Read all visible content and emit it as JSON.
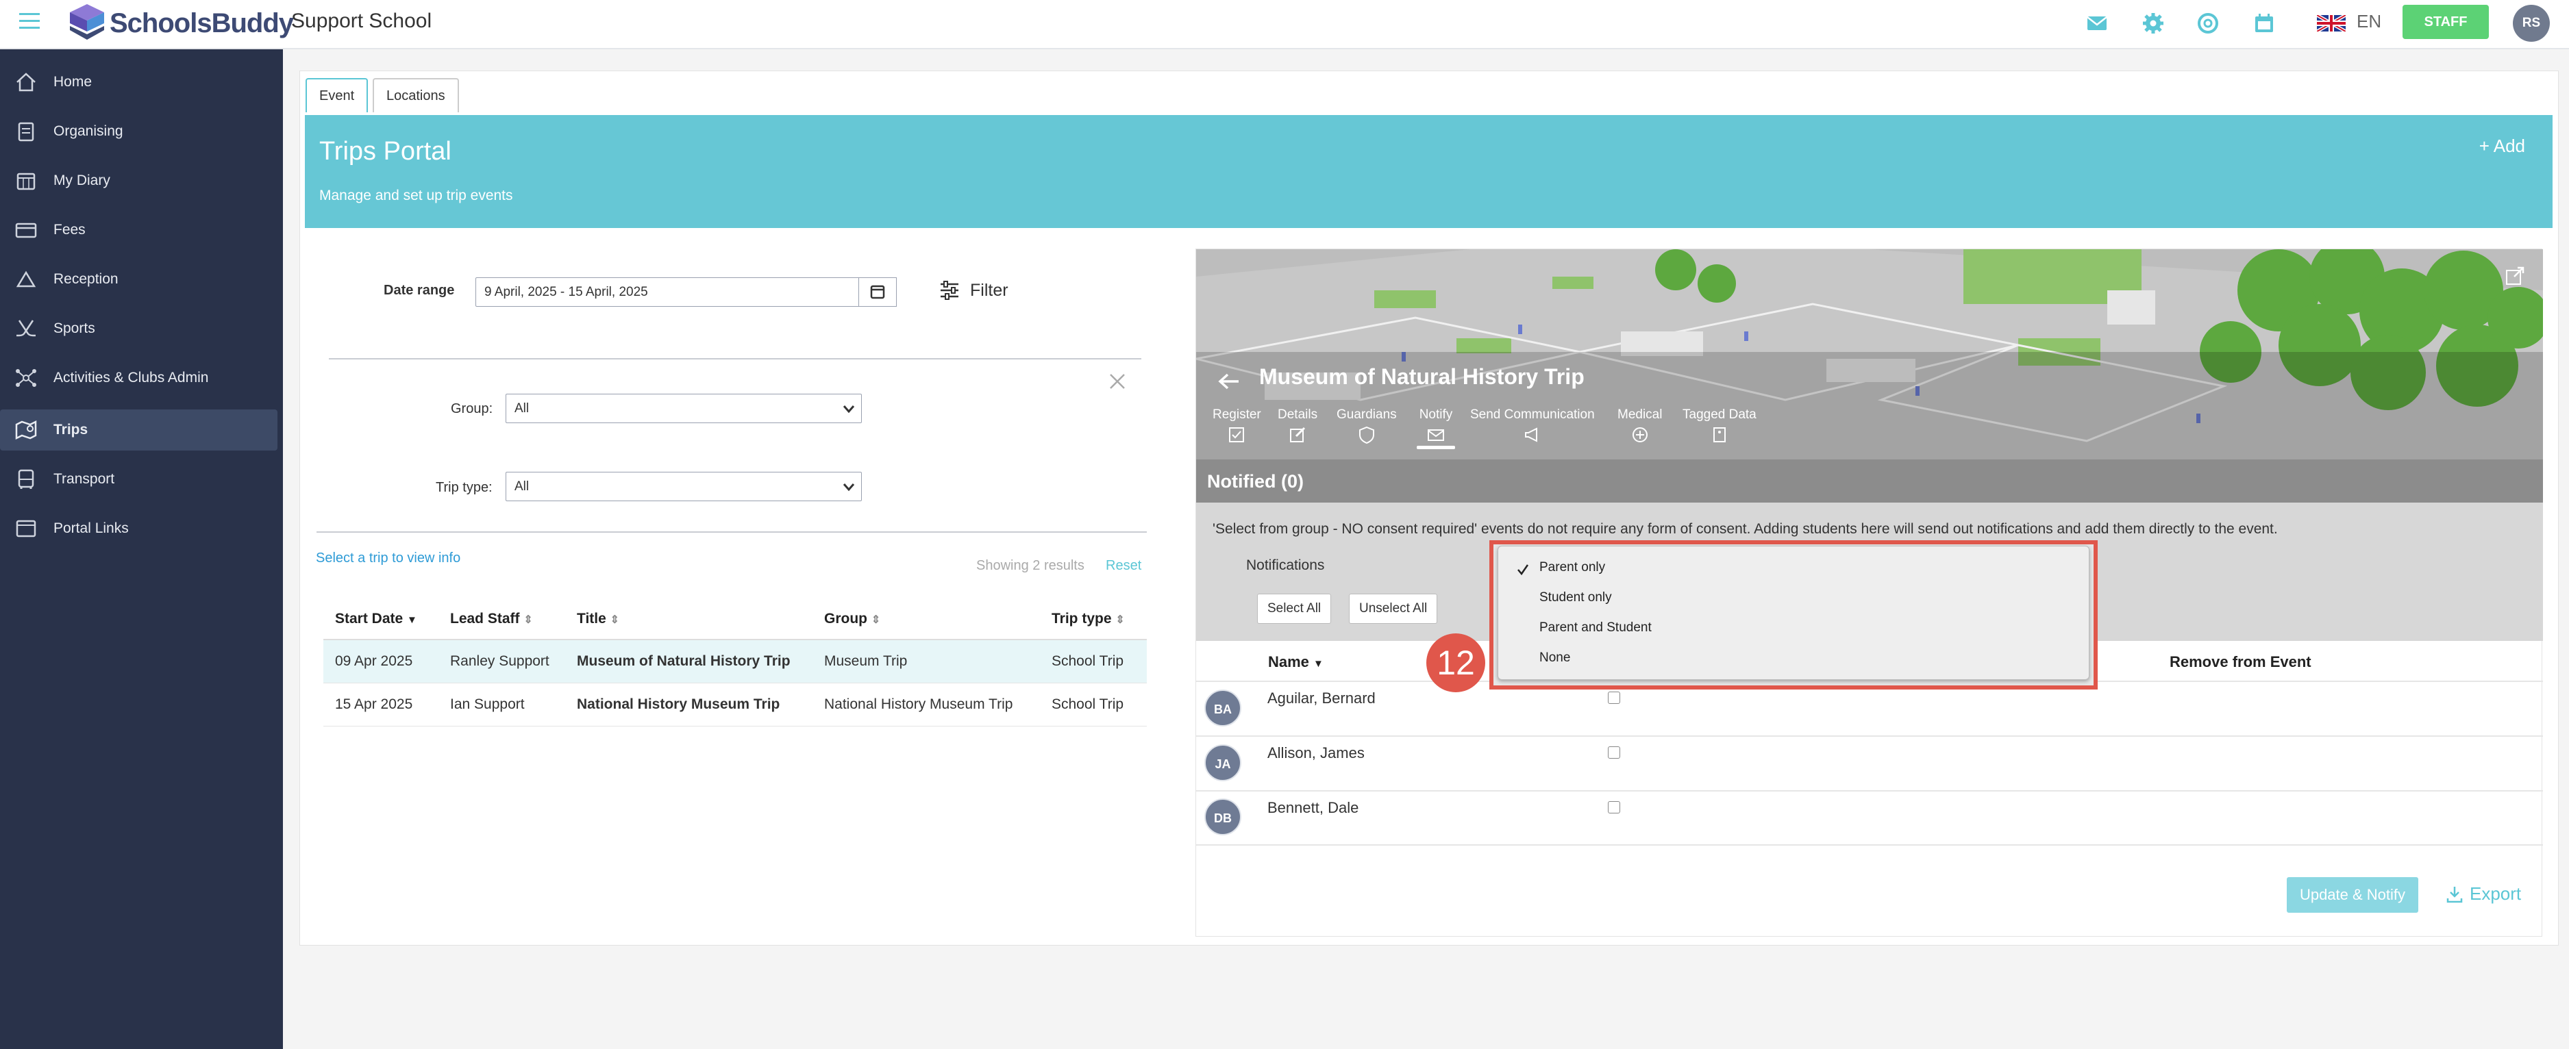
{
  "header": {
    "brand": "SchoolsBuddy",
    "school": "Support School",
    "language": "EN",
    "staff_badge": "STAFF",
    "user_initials": "RS",
    "icons": [
      "menu-icon",
      "mail-icon",
      "gear-icon",
      "support-icon",
      "calendar-icon",
      "uk-flag-icon"
    ],
    "colors": {
      "accent": "#66c7d5",
      "staff": "#5cd275",
      "sidebar": "#29324a"
    }
  },
  "sidebar": {
    "items": [
      {
        "label": "Home",
        "icon": "home-icon"
      },
      {
        "label": "Organising",
        "icon": "clipboard-icon"
      },
      {
        "label": "My Diary",
        "icon": "calendar-icon"
      },
      {
        "label": "Fees",
        "icon": "card-icon"
      },
      {
        "label": "Reception",
        "icon": "bell-icon"
      },
      {
        "label": "Sports",
        "icon": "hockey-icon"
      },
      {
        "label": "Activities & Clubs Admin",
        "icon": "network-icon"
      },
      {
        "label": "Trips",
        "icon": "map-icon"
      },
      {
        "label": "Transport",
        "icon": "bus-icon"
      },
      {
        "label": "Portal Links",
        "icon": "window-icon"
      }
    ],
    "active": "Trips"
  },
  "tabs": [
    "Event",
    "Locations"
  ],
  "portal": {
    "title": "Trips Portal",
    "subtitle": "Manage and set up trip events",
    "add_label": "+ Add"
  },
  "filters": {
    "date_range_label": "Date range",
    "date_range_value": "9 April, 2025 - 15 April, 2025",
    "filter_label": "Filter",
    "group_label": "Group:",
    "group_value": "All",
    "trip_type_label": "Trip type:",
    "trip_type_value": "All",
    "select_hint": "Select a trip to view info",
    "showing": "Showing 2 results",
    "reset": "Reset"
  },
  "trips_table": {
    "columns": [
      "Start Date",
      "Lead Staff",
      "Title",
      "Group",
      "Trip type"
    ],
    "rows": [
      {
        "start": "09 Apr 2025",
        "staff": "Ranley Support",
        "title": "Museum of Natural History Trip",
        "group": "Museum Trip",
        "type": "School Trip"
      },
      {
        "start": "15 Apr 2025",
        "staff": "Ian Support",
        "title": "National History Museum Trip",
        "group": "National History Museum Trip",
        "type": "School Trip"
      }
    ]
  },
  "detail": {
    "title": "Museum of Natural History Trip",
    "tabs": [
      "Register",
      "Details",
      "Guardians",
      "Notify",
      "Send Communication",
      "Medical",
      "Tagged Data"
    ],
    "active_tab": "Notify",
    "notified_title": "Notified (0)",
    "consent_text": "'Select from group - NO consent required' events do not require any form of consent. Adding students here will send out notifications and add them directly to the event.",
    "notifications_label": "Notifications",
    "select_all": "Select All",
    "unselect_all": "Unselect All",
    "col_name": "Name",
    "col_remove": "Remove from Event",
    "students": [
      {
        "initials": "BA",
        "name": "Aguilar, Bernard"
      },
      {
        "initials": "JA",
        "name": "Allison, James"
      },
      {
        "initials": "DB",
        "name": "Bennett, Dale"
      }
    ],
    "update_notify": "Update & Notify",
    "export": "Export"
  },
  "dropdown": {
    "options": [
      "Parent only",
      "Student only",
      "Parent and Student",
      "None"
    ],
    "selected": "Parent only"
  },
  "step_badge": "12"
}
